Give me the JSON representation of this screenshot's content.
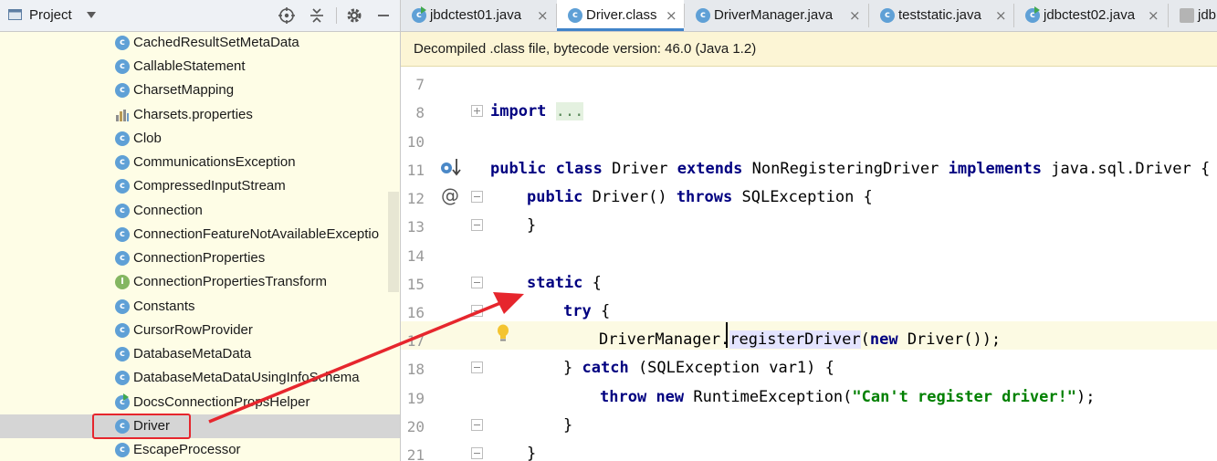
{
  "project_panel": {
    "title": "Project",
    "tree": [
      {
        "label": "CachedResultSetMetaData",
        "kind": "class"
      },
      {
        "label": "CallableStatement",
        "kind": "class"
      },
      {
        "label": "CharsetMapping",
        "kind": "class"
      },
      {
        "label": "Charsets.properties",
        "kind": "properties"
      },
      {
        "label": "Clob",
        "kind": "class"
      },
      {
        "label": "CommunicationsException",
        "kind": "class"
      },
      {
        "label": "CompressedInputStream",
        "kind": "class"
      },
      {
        "label": "Connection",
        "kind": "class"
      },
      {
        "label": "ConnectionFeatureNotAvailableExceptio",
        "kind": "class"
      },
      {
        "label": "ConnectionProperties",
        "kind": "class"
      },
      {
        "label": "ConnectionPropertiesTransform",
        "kind": "interface"
      },
      {
        "label": "Constants",
        "kind": "class"
      },
      {
        "label": "CursorRowProvider",
        "kind": "class"
      },
      {
        "label": "DatabaseMetaData",
        "kind": "class"
      },
      {
        "label": "DatabaseMetaDataUsingInfoSchema",
        "kind": "class"
      },
      {
        "label": "DocsConnectionPropsHelper",
        "kind": "runnable-class"
      },
      {
        "label": "Driver",
        "kind": "class",
        "selected": true
      },
      {
        "label": "EscapeProcessor",
        "kind": "class"
      }
    ]
  },
  "tabs": [
    {
      "label": "jbdctest01.java",
      "icon": "runnable-class-icon"
    },
    {
      "label": "Driver.class",
      "icon": "class-icon",
      "active": true
    },
    {
      "label": "DriverManager.java",
      "icon": "class-icon"
    },
    {
      "label": "teststatic.java",
      "icon": "class-icon"
    },
    {
      "label": "jdbctest02.java",
      "icon": "runnable-class-icon"
    },
    {
      "label": "jdb",
      "icon": "file-icon"
    }
  ],
  "banner": {
    "text": "Decompiled .class file, bytecode version: 46.0 (Java 1.2)"
  },
  "code": {
    "line_numbers": [
      "7",
      "8",
      "10",
      "11",
      "12",
      "13",
      "14",
      "15",
      "16",
      "17",
      "18",
      "19",
      "20",
      "21"
    ],
    "l8": {
      "kw": "import",
      "fold": "..."
    },
    "l11": {
      "k1": "public class",
      "t1": "Driver",
      "k2": "extends",
      "t2": "NonRegisteringDriver",
      "k3": "implements",
      "t3": "java.sql.Driver {"
    },
    "l12": {
      "k1": "public",
      "t1": "Driver()",
      "k2": "throws",
      "t2": "SQLException {"
    },
    "l13": {
      "t1": "}"
    },
    "l15": {
      "k1": "static",
      "t1": "{"
    },
    "l16": {
      "k1": "try",
      "t1": "{"
    },
    "l17": {
      "t1": "DriverManager.",
      "hl": "registerDriver",
      "t2": "(",
      "k1": "new",
      "t3": "Driver());"
    },
    "l18": {
      "t1": "}",
      "k1": "catch",
      "t2": "(SQLException var1) {"
    },
    "l19": {
      "k1": "throw",
      "k2": "new",
      "t1": "RuntimeException(",
      "str": "\"Can't register driver!\"",
      "t2": ");"
    },
    "l20": {
      "t1": "}"
    },
    "l21": {
      "t1": "}"
    }
  },
  "colors": {
    "keyword": "#000080",
    "string": "#008000",
    "selection": "#d5d5d5",
    "annotation": "#e6262d",
    "banner": "#fcf5d5"
  }
}
